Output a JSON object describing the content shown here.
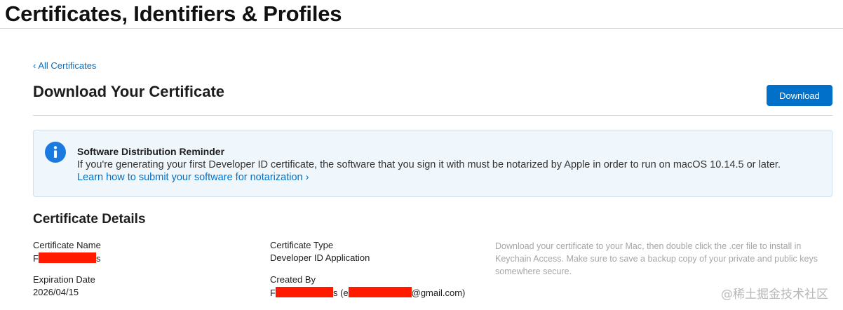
{
  "header": {
    "title": "Certificates, Identifiers & Profiles"
  },
  "nav": {
    "back_chevron": "‹",
    "back_label": "All Certificates"
  },
  "main": {
    "heading": "Download Your Certificate",
    "download_label": "Download"
  },
  "notice": {
    "icon": "info-icon",
    "title": "Software Distribution Reminder",
    "body": "If you're generating your first Developer ID certificate, the software that you sign it with must be notarized by Apple in order to run on macOS 10.14.5 or later.",
    "link": "Learn how to submit your software for notarization ›"
  },
  "details": {
    "heading": "Certificate Details",
    "name_label": "Certificate Name",
    "name_prefix": "F",
    "name_suffix": "s",
    "type_label": "Certificate Type",
    "type_value": "Developer ID Application",
    "expiration_label": "Expiration Date",
    "expiration_value": "2026/04/15",
    "created_label": "Created By",
    "created_prefix": "F",
    "created_middle": "s (e",
    "created_suffix": "@gmail.com)",
    "helper": "Download your certificate to your Mac, then double click the .cer file to install in Keychain Access. Make sure to save a backup copy of your private and public keys somewhere secure."
  },
  "watermark": "@稀土掘金技术社区",
  "colors": {
    "accent": "#0070c9",
    "notice_bg": "#f0f7fc",
    "redaction": "#ff1a00"
  }
}
